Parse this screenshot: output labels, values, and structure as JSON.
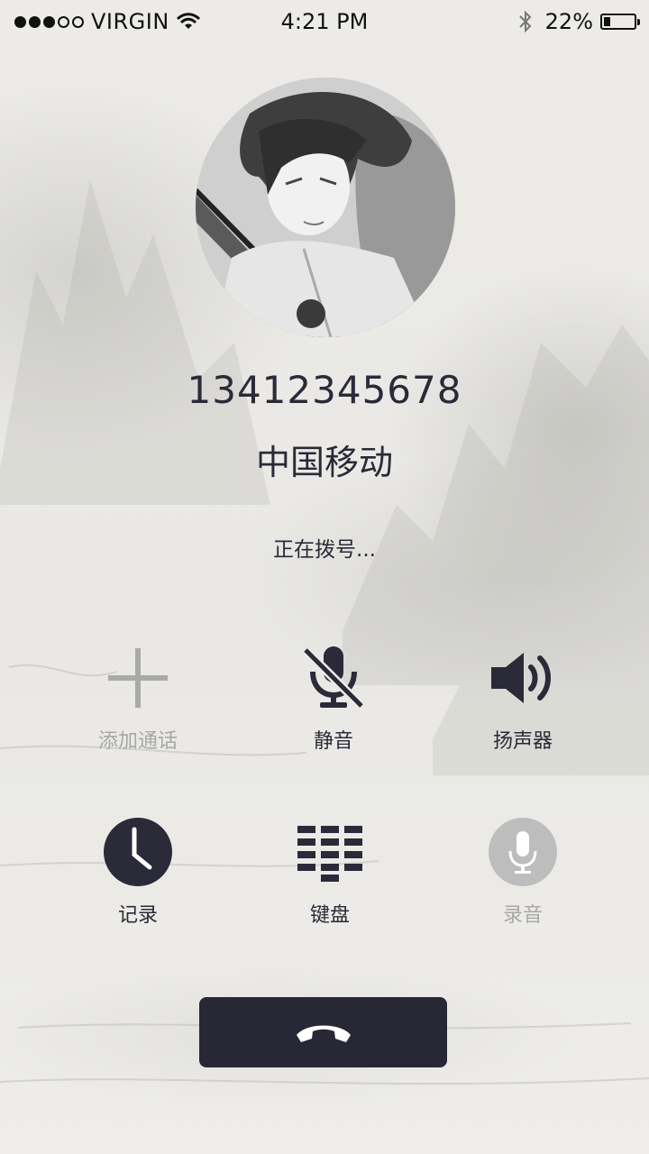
{
  "status_bar": {
    "signal_strength": "3 of 5",
    "carrier": "VIRGIN",
    "time": "4:21 PM",
    "battery_percent": "22%",
    "battery_level": 0.22,
    "icons": [
      "signal-dots",
      "wifi-icon",
      "bluetooth-icon",
      "battery-icon"
    ]
  },
  "call": {
    "avatar_icon": "contact-avatar-ink-portrait",
    "number": "13412345678",
    "carrier": "中国移动",
    "status": "正在拨号..."
  },
  "actions": [
    {
      "label": "添加通话",
      "icon": "add-call-icon",
      "enabled": false
    },
    {
      "label": "静音",
      "icon": "mute-mic-icon",
      "enabled": true
    },
    {
      "label": "扬声器",
      "icon": "speaker-icon",
      "enabled": true
    },
    {
      "label": "记录",
      "icon": "clock-icon",
      "enabled": true
    },
    {
      "label": "键盘",
      "icon": "keypad-icon",
      "enabled": true
    },
    {
      "label": "录音",
      "icon": "record-mic-icon",
      "enabled": false
    }
  ],
  "end_call": {
    "icon": "hang-up-icon",
    "color": "#272736"
  },
  "colors": {
    "text_primary": "#2a2a38",
    "text_disabled": "#a7a7a7",
    "background": "#ecebe7"
  }
}
